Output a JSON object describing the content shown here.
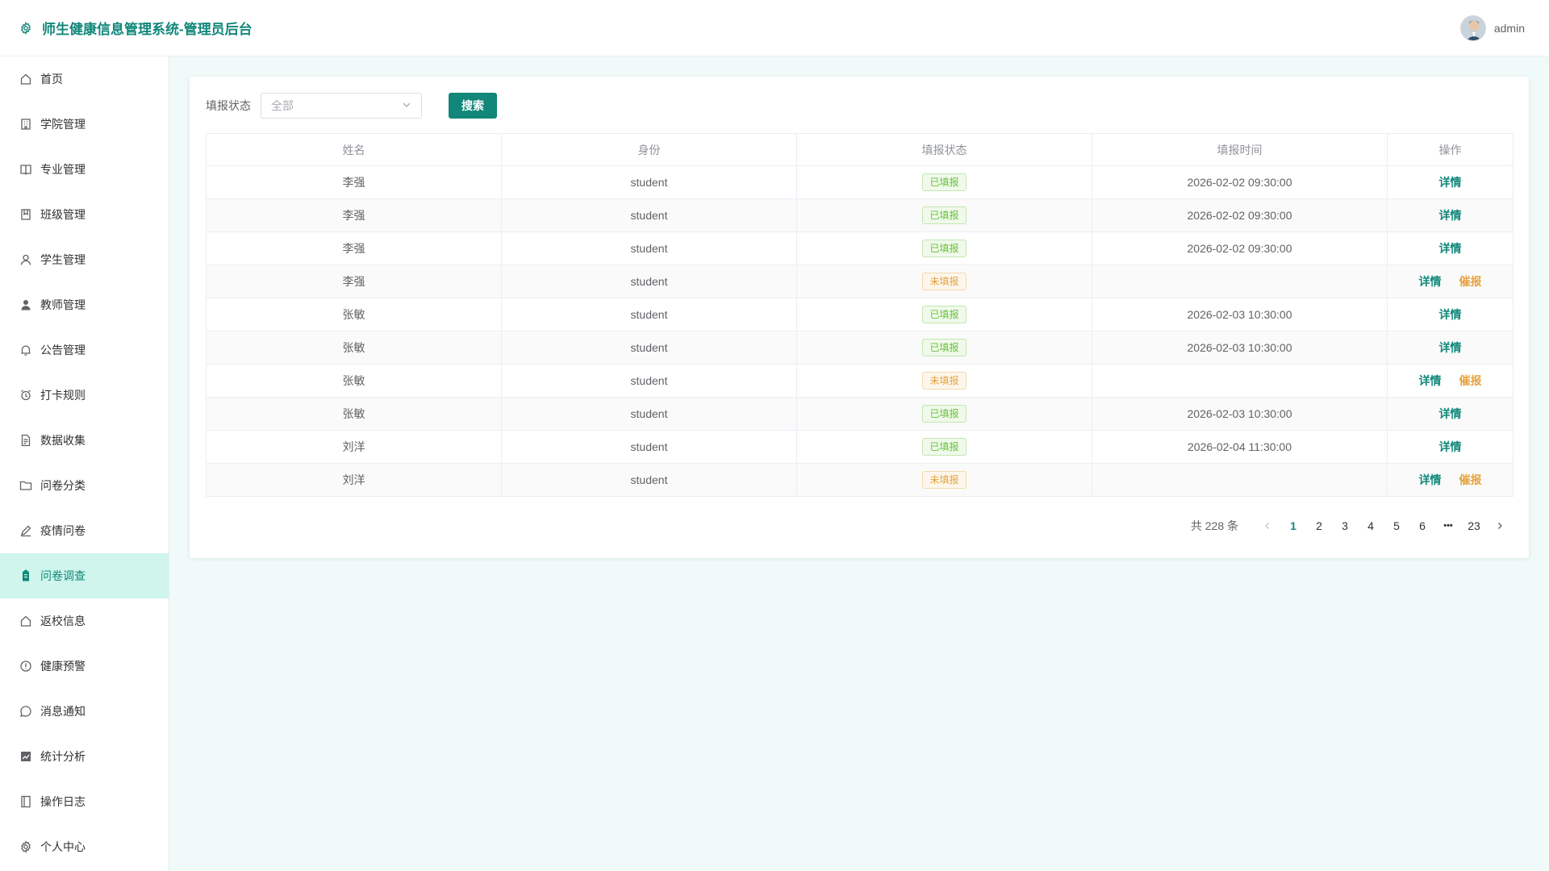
{
  "header": {
    "title": "师生健康信息管理系统-管理员后台",
    "username": "admin"
  },
  "sidebar": {
    "items": [
      {
        "label": "首页",
        "icon": "home-icon"
      },
      {
        "label": "学院管理",
        "icon": "building-icon"
      },
      {
        "label": "专业管理",
        "icon": "book-open-icon"
      },
      {
        "label": "班级管理",
        "icon": "class-icon"
      },
      {
        "label": "学生管理",
        "icon": "user-icon"
      },
      {
        "label": "教师管理",
        "icon": "user-solid-icon"
      },
      {
        "label": "公告管理",
        "icon": "bell-icon"
      },
      {
        "label": "打卡规则",
        "icon": "alarm-clock-icon"
      },
      {
        "label": "数据收集",
        "icon": "document-icon"
      },
      {
        "label": "问卷分类",
        "icon": "folder-icon"
      },
      {
        "label": "疫情问卷",
        "icon": "edit-pen-icon"
      },
      {
        "label": "问卷调查",
        "icon": "clipboard-icon",
        "active": true
      },
      {
        "label": "返校信息",
        "icon": "house-icon"
      },
      {
        "label": "健康预警",
        "icon": "warning-icon"
      },
      {
        "label": "消息通知",
        "icon": "chat-icon"
      },
      {
        "label": "统计分析",
        "icon": "chart-icon"
      },
      {
        "label": "操作日志",
        "icon": "notebook-icon"
      },
      {
        "label": "个人中心",
        "icon": "gear-icon"
      }
    ]
  },
  "filter": {
    "label": "填报状态",
    "select_value": "全部",
    "search_label": "搜索"
  },
  "table": {
    "columns": [
      "姓名",
      "身份",
      "填报状态",
      "填报时间",
      "操作"
    ],
    "rows": [
      {
        "name": "李强",
        "role": "student",
        "status": "已填报",
        "done": true,
        "time": "2026-02-02 09:30:00"
      },
      {
        "name": "李强",
        "role": "student",
        "status": "已填报",
        "done": true,
        "time": "2026-02-02 09:30:00"
      },
      {
        "name": "李强",
        "role": "student",
        "status": "已填报",
        "done": true,
        "time": "2026-02-02 09:30:00"
      },
      {
        "name": "李强",
        "role": "student",
        "status": "未填报",
        "done": false,
        "time": ""
      },
      {
        "name": "张敏",
        "role": "student",
        "status": "已填报",
        "done": true,
        "time": "2026-02-03 10:30:00"
      },
      {
        "name": "张敏",
        "role": "student",
        "status": "已填报",
        "done": true,
        "time": "2026-02-03 10:30:00"
      },
      {
        "name": "张敏",
        "role": "student",
        "status": "未填报",
        "done": false,
        "time": ""
      },
      {
        "name": "张敏",
        "role": "student",
        "status": "已填报",
        "done": true,
        "time": "2026-02-03 10:30:00"
      },
      {
        "name": "刘洋",
        "role": "student",
        "status": "已填报",
        "done": true,
        "time": "2026-02-04 11:30:00"
      },
      {
        "name": "刘洋",
        "role": "student",
        "status": "未填报",
        "done": false,
        "time": ""
      }
    ],
    "detail_label": "详情",
    "urge_label": "催报"
  },
  "pagination": {
    "total_text": "共 228 条",
    "pages": [
      "1",
      "2",
      "3",
      "4",
      "5",
      "6"
    ],
    "current": "1",
    "ellipsis": "•••",
    "last": "23"
  },
  "colors": {
    "accent": "#11877a",
    "done": "#67c23a",
    "pending": "#e6a23c"
  }
}
